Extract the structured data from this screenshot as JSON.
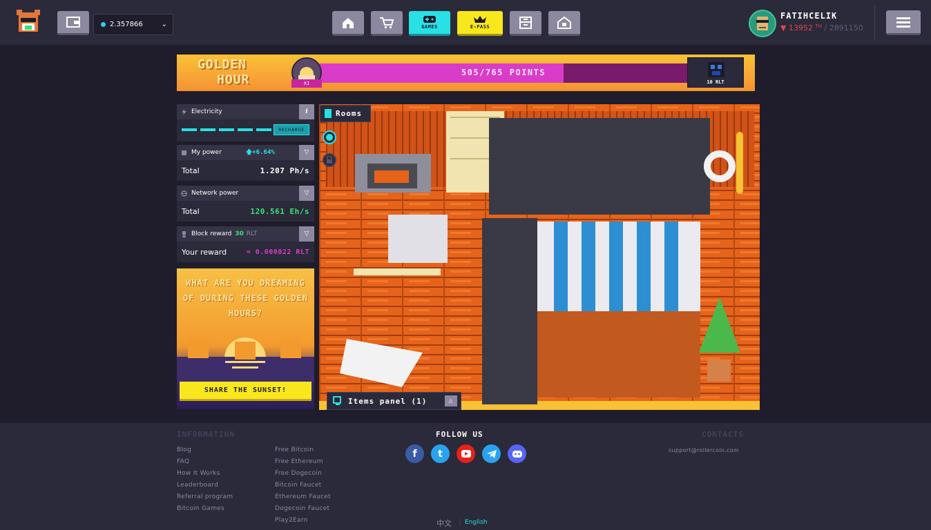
{
  "header": {
    "balance": "2.357866",
    "nav": [
      "home",
      "marketplace",
      "games",
      "e-pass",
      "storage",
      "my-room"
    ],
    "games_label": "GAMES",
    "epass_label": "E-PASS",
    "username": "FATIHCELIK",
    "user_rank": "▼ 13952",
    "user_rank_unit": "TH",
    "user_total": "/ 2891150"
  },
  "banner": {
    "title_line1": "GOLDEN",
    "title_line2": "HOUR",
    "multiplier": "X1",
    "points": "505/765 POINTS",
    "points_progress": 0.66,
    "reward": "10 RLT"
  },
  "stats": {
    "electricity_label": "Electricity",
    "recharge_label": "RECHARGE",
    "my_power_label": "My power",
    "my_power_change": "+6.64%",
    "total_label": "Total",
    "my_power_total": "1.207 Ph/s",
    "network_power_label": "Network power",
    "network_power_total": "120.561 Eh/s",
    "block_reward_label": "Block reward",
    "block_reward_value": "30",
    "block_reward_unit": "RLT",
    "your_reward_label": "Your reward",
    "your_reward_value": "≈ 0.000822 RLT"
  },
  "promo": {
    "text": "WHAT ARE YOU DREAMING OF DURING THESE GOLDEN HOURS?",
    "button": "SHARE THE SUNSET!"
  },
  "room": {
    "rooms_tab": "Rooms",
    "items_panel": "Items panel (1)"
  },
  "footer": {
    "information_heading": "INFORMATION",
    "info_links_col1": [
      "Blog",
      "FAQ",
      "How It Works",
      "Leaderboard",
      "Referral program",
      "Bitcoin Games"
    ],
    "info_links_col2": [
      "Free Bitcoin",
      "Free Ethereum",
      "Free Dogecoin",
      "Bitcoin Faucet",
      "Ethereum Faucet",
      "Dogecoin Faucet",
      "Play2Earn"
    ],
    "follow_heading": "FOLLOW US",
    "socials": [
      "facebook",
      "twitter",
      "youtube",
      "telegram",
      "discord"
    ],
    "contacts_heading": "CONTACTS",
    "email": "support@rollercoin.com",
    "lang_zh": "中文",
    "lang_en": "English"
  },
  "colors": {
    "accent_cyan": "#29e0e5",
    "accent_yellow": "#f9e71d",
    "accent_magenta": "#d93cc7",
    "positive_green": "#3ae374",
    "danger_red": "#e5424d"
  }
}
